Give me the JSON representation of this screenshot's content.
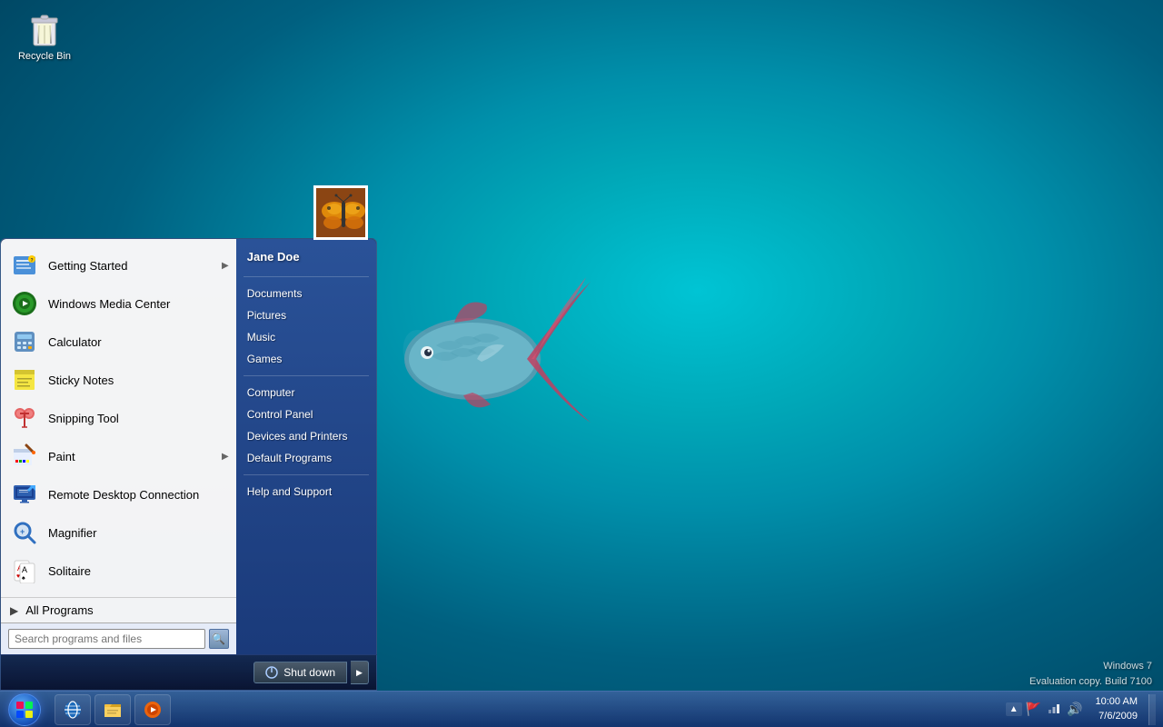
{
  "desktop": {
    "bg_color_start": "#00c4d4",
    "bg_color_end": "#003a55"
  },
  "recycle_bin": {
    "label": "Recycle Bin"
  },
  "start_menu": {
    "user_name": "Jane Doe",
    "pinned_items": [
      {
        "id": "getting-started",
        "label": "Getting Started",
        "has_arrow": true
      },
      {
        "id": "windows-media-center",
        "label": "Windows Media Center",
        "has_arrow": false
      },
      {
        "id": "calculator",
        "label": "Calculator",
        "has_arrow": false
      },
      {
        "id": "sticky-notes",
        "label": "Sticky Notes",
        "has_arrow": false
      },
      {
        "id": "snipping-tool",
        "label": "Snipping Tool",
        "has_arrow": false
      },
      {
        "id": "paint",
        "label": "Paint",
        "has_arrow": true
      },
      {
        "id": "remote-desktop-connection",
        "label": "Remote Desktop Connection",
        "has_arrow": false
      },
      {
        "id": "magnifier",
        "label": "Magnifier",
        "has_arrow": false
      },
      {
        "id": "solitaire",
        "label": "Solitaire",
        "has_arrow": false
      }
    ],
    "all_programs_label": "All Programs",
    "search_placeholder": "Search programs and files",
    "right_items": [
      {
        "id": "documents",
        "label": "Documents"
      },
      {
        "id": "pictures",
        "label": "Pictures"
      },
      {
        "id": "music",
        "label": "Music"
      },
      {
        "id": "games",
        "label": "Games"
      },
      {
        "id": "computer",
        "label": "Computer"
      },
      {
        "id": "control-panel",
        "label": "Control Panel"
      },
      {
        "id": "devices-and-printers",
        "label": "Devices and Printers"
      },
      {
        "id": "default-programs",
        "label": "Default Programs"
      },
      {
        "id": "help-and-support",
        "label": "Help and Support"
      }
    ],
    "shutdown_label": "Shut down"
  },
  "taskbar": {
    "items": [
      {
        "id": "ie",
        "label": "Internet Explorer"
      },
      {
        "id": "file-explorer",
        "label": "Windows Explorer"
      },
      {
        "id": "media-player",
        "label": "Windows Media Player"
      }
    ],
    "clock_time": "10:00 AM",
    "clock_date": "7/6/2009"
  },
  "windows_version": {
    "line1": "Windows 7",
    "line2": "Evaluation copy. Build 7100"
  }
}
